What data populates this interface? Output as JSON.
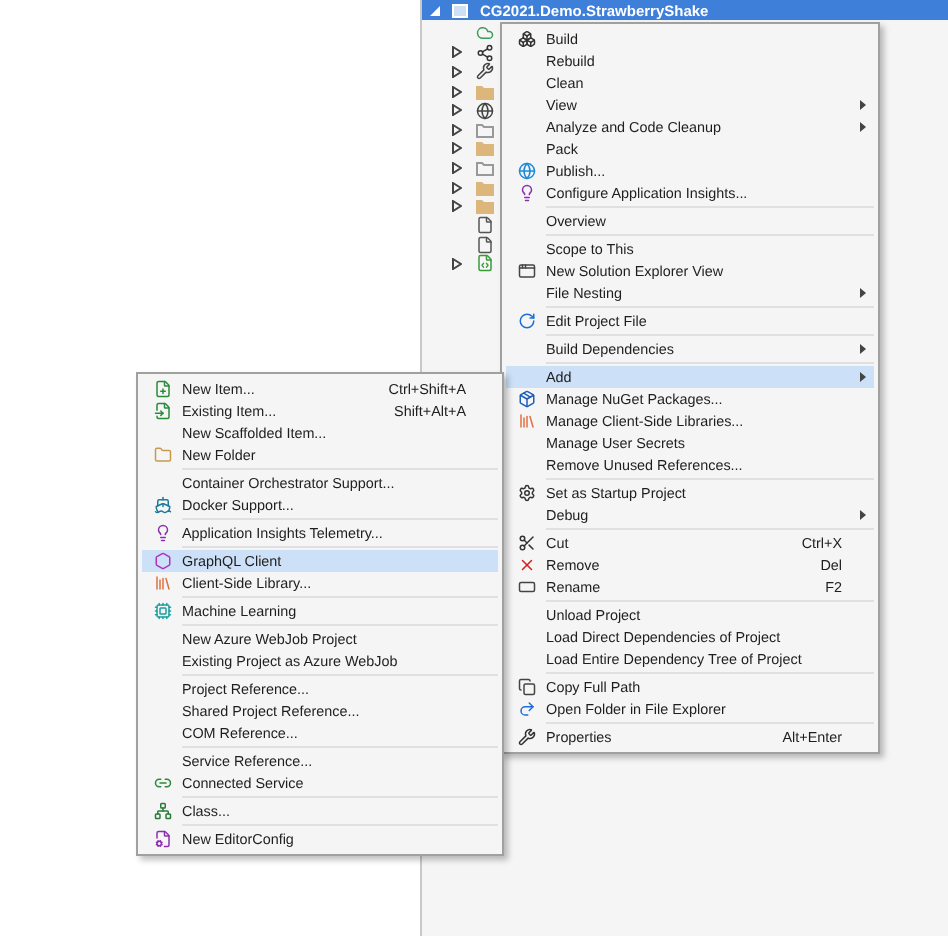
{
  "solution_explorer": {
    "title": "CG2021.Demo.StrawberryShake",
    "nodes": [
      {
        "kind": "cloud",
        "expandable": false
      },
      {
        "kind": "dependencies",
        "expandable": true
      },
      {
        "kind": "properties",
        "expandable": true
      },
      {
        "kind": "folder",
        "expandable": true
      },
      {
        "kind": "globe",
        "expandable": true
      },
      {
        "kind": "empty-folder",
        "expandable": true
      },
      {
        "kind": "folder",
        "expandable": true
      },
      {
        "kind": "empty-folder",
        "expandable": true
      },
      {
        "kind": "folder",
        "expandable": true
      },
      {
        "kind": "folder",
        "expandable": true
      },
      {
        "kind": "file",
        "expandable": false
      },
      {
        "kind": "file",
        "expandable": false
      },
      {
        "kind": "code",
        "expandable": true
      }
    ]
  },
  "context_menu": {
    "groups": [
      [
        {
          "label": "Build",
          "kind": "build",
          "highlighted": false,
          "submenu": false
        },
        {
          "label": "Rebuild",
          "highlighted": false,
          "submenu": false
        },
        {
          "label": "Clean",
          "highlighted": false,
          "submenu": false
        },
        {
          "label": "View",
          "highlighted": false,
          "submenu": true
        },
        {
          "label": "Analyze and Code Cleanup",
          "highlighted": false,
          "submenu": true
        },
        {
          "label": "Pack",
          "highlighted": false,
          "submenu": false
        },
        {
          "label": "Publish...",
          "kind": "publish",
          "highlighted": false,
          "submenu": false
        },
        {
          "label": "Configure Application Insights...",
          "kind": "insights",
          "highlighted": false,
          "submenu": false
        }
      ],
      [
        {
          "label": "Overview",
          "highlighted": false,
          "submenu": false
        }
      ],
      [
        {
          "label": "Scope to This",
          "highlighted": false,
          "submenu": false
        },
        {
          "label": "New Solution Explorer View",
          "kind": "window",
          "highlighted": false,
          "submenu": false
        },
        {
          "label": "File Nesting",
          "highlighted": false,
          "submenu": true
        }
      ],
      [
        {
          "label": "Edit Project File",
          "kind": "edit",
          "highlighted": false,
          "submenu": false
        }
      ],
      [
        {
          "label": "Build Dependencies",
          "highlighted": false,
          "submenu": true
        }
      ],
      [
        {
          "label": "Add",
          "highlighted": true,
          "submenu": true
        },
        {
          "label": "Manage NuGet Packages...",
          "kind": "nuget",
          "highlighted": false,
          "submenu": false
        },
        {
          "label": "Manage Client-Side Libraries...",
          "kind": "libraries",
          "highlighted": false,
          "submenu": false
        },
        {
          "label": "Manage User Secrets",
          "highlighted": false,
          "submenu": false
        },
        {
          "label": "Remove Unused References...",
          "highlighted": false,
          "submenu": false
        }
      ],
      [
        {
          "label": "Set as Startup Project",
          "kind": "gear",
          "highlighted": false,
          "submenu": false
        },
        {
          "label": "Debug",
          "highlighted": false,
          "submenu": true
        }
      ],
      [
        {
          "label": "Cut",
          "kind": "cut",
          "shortcut": "Ctrl+X",
          "highlighted": false,
          "submenu": false
        },
        {
          "label": "Remove",
          "kind": "remove",
          "shortcut": "Del",
          "highlighted": false,
          "submenu": false
        },
        {
          "label": "Rename",
          "kind": "rename",
          "shortcut": "F2",
          "highlighted": false,
          "submenu": false
        }
      ],
      [
        {
          "label": "Unload Project",
          "highlighted": false,
          "submenu": false
        },
        {
          "label": "Load Direct Dependencies of Project",
          "highlighted": false,
          "submenu": false
        },
        {
          "label": "Load Entire Dependency Tree of Project",
          "highlighted": false,
          "submenu": false
        }
      ],
      [
        {
          "label": "Copy Full Path",
          "kind": "copy",
          "highlighted": false,
          "submenu": false
        },
        {
          "label": "Open Folder in File Explorer",
          "kind": "open",
          "highlighted": false,
          "submenu": false
        }
      ],
      [
        {
          "label": "Properties",
          "kind": "properties",
          "shortcut": "Alt+Enter",
          "highlighted": false,
          "submenu": false
        }
      ]
    ]
  },
  "add_submenu": {
    "groups": [
      [
        {
          "label": "New Item...",
          "kind": "new-item",
          "shortcut": "Ctrl+Shift+A",
          "highlighted": false
        },
        {
          "label": "Existing Item...",
          "kind": "existing-item",
          "shortcut": "Shift+Alt+A",
          "highlighted": false
        },
        {
          "label": "New Scaffolded Item...",
          "highlighted": false
        },
        {
          "label": "New Folder",
          "kind": "folder",
          "highlighted": false
        }
      ],
      [
        {
          "label": "Container Orchestrator Support...",
          "highlighted": false
        },
        {
          "label": "Docker Support...",
          "kind": "docker",
          "highlighted": false
        }
      ],
      [
        {
          "label": "Application Insights Telemetry...",
          "kind": "insights",
          "highlighted": false
        }
      ],
      [
        {
          "label": "GraphQL Client",
          "kind": "graphql",
          "highlighted": true
        },
        {
          "label": "Client-Side Library...",
          "kind": "libraries",
          "highlighted": false
        }
      ],
      [
        {
          "label": "Machine Learning",
          "kind": "ml",
          "highlighted": false
        }
      ],
      [
        {
          "label": "New Azure WebJob Project",
          "highlighted": false
        },
        {
          "label": "Existing Project as Azure WebJob",
          "highlighted": false
        }
      ],
      [
        {
          "label": "Project Reference...",
          "highlighted": false
        },
        {
          "label": "Shared Project Reference...",
          "highlighted": false
        },
        {
          "label": "COM Reference...",
          "highlighted": false
        }
      ],
      [
        {
          "label": "Service Reference...",
          "highlighted": false
        },
        {
          "label": "Connected Service",
          "kind": "connected",
          "highlighted": false
        }
      ],
      [
        {
          "label": "Class...",
          "kind": "class",
          "highlighted": false
        }
      ],
      [
        {
          "label": "New EditorConfig",
          "kind": "editorconfig",
          "highlighted": false
        }
      ]
    ]
  }
}
